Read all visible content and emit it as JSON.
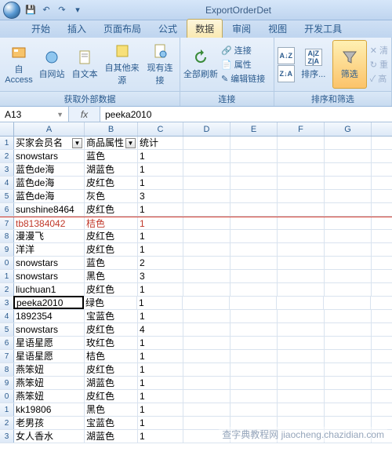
{
  "window": {
    "title": "ExportOrderDet"
  },
  "qat": {
    "save": "💾",
    "undo": "↶",
    "redo": "↷"
  },
  "tabs": [
    "开始",
    "插入",
    "页面布局",
    "公式",
    "数据",
    "审阅",
    "视图",
    "开发工具"
  ],
  "active_tab_index": 4,
  "ribbon": {
    "group1": {
      "label": "获取外部数据",
      "btn_access": "自 Access",
      "btn_web": "自网站",
      "btn_text": "自文本",
      "btn_other": "自其他来源",
      "btn_conn": "现有连接"
    },
    "group2": {
      "label": "连接",
      "btn_refresh": "全部刷新",
      "lnk_conn": "连接",
      "lnk_prop": "属性",
      "lnk_edit": "编辑链接"
    },
    "group3": {
      "label": "排序和筛选",
      "btn_sort": "排序...",
      "btn_filter": "筛选"
    }
  },
  "namebox": "A13",
  "fx_label": "fx",
  "formula": "peeka2010",
  "columns": [
    "A",
    "B",
    "C",
    "D",
    "E",
    "F",
    "G"
  ],
  "headers": {
    "a": "买家会员名",
    "b": "商品属性",
    "c": "统计"
  },
  "chart_data": {
    "type": "table",
    "columns": [
      "买家会员名",
      "商品属性",
      "统计"
    ],
    "rows": [
      [
        "snowstars",
        "蓝色",
        1
      ],
      [
        "蓝色de海",
        "湖蓝色",
        1
      ],
      [
        "蓝色de海",
        "皮红色",
        1
      ],
      [
        "蓝色de海",
        "灰色",
        3
      ],
      [
        "sunshine8464",
        "皮红色",
        1
      ],
      [
        "tb81384042",
        "桔色",
        1
      ],
      [
        "漫漫飞",
        "皮红色",
        1
      ],
      [
        "洋洋",
        "皮红色",
        1
      ],
      [
        "snowstars",
        "蓝色",
        2
      ],
      [
        "snowstars",
        "黑色",
        3
      ],
      [
        "liuchuan1",
        "皮红色",
        1
      ],
      [
        "peeka2010",
        "绿色",
        1
      ],
      [
        "1892354",
        "宝蓝色",
        1
      ],
      [
        "snowstars",
        "皮红色",
        4
      ],
      [
        "星语星愿",
        "玫红色",
        1
      ],
      [
        "星语星愿",
        "桔色",
        1
      ],
      [
        "燕笨妞",
        "皮红色",
        1
      ],
      [
        "燕笨妞",
        "湖蓝色",
        1
      ],
      [
        "燕笨妞",
        "皮红色",
        1
      ],
      [
        "kk19806",
        "黑色",
        1
      ],
      [
        "老男孩",
        "宝蓝色",
        1
      ],
      [
        "女人香水",
        "湖蓝色",
        1
      ]
    ]
  },
  "watermark": "查字典教程网 jiaocheng.chazidian.com"
}
